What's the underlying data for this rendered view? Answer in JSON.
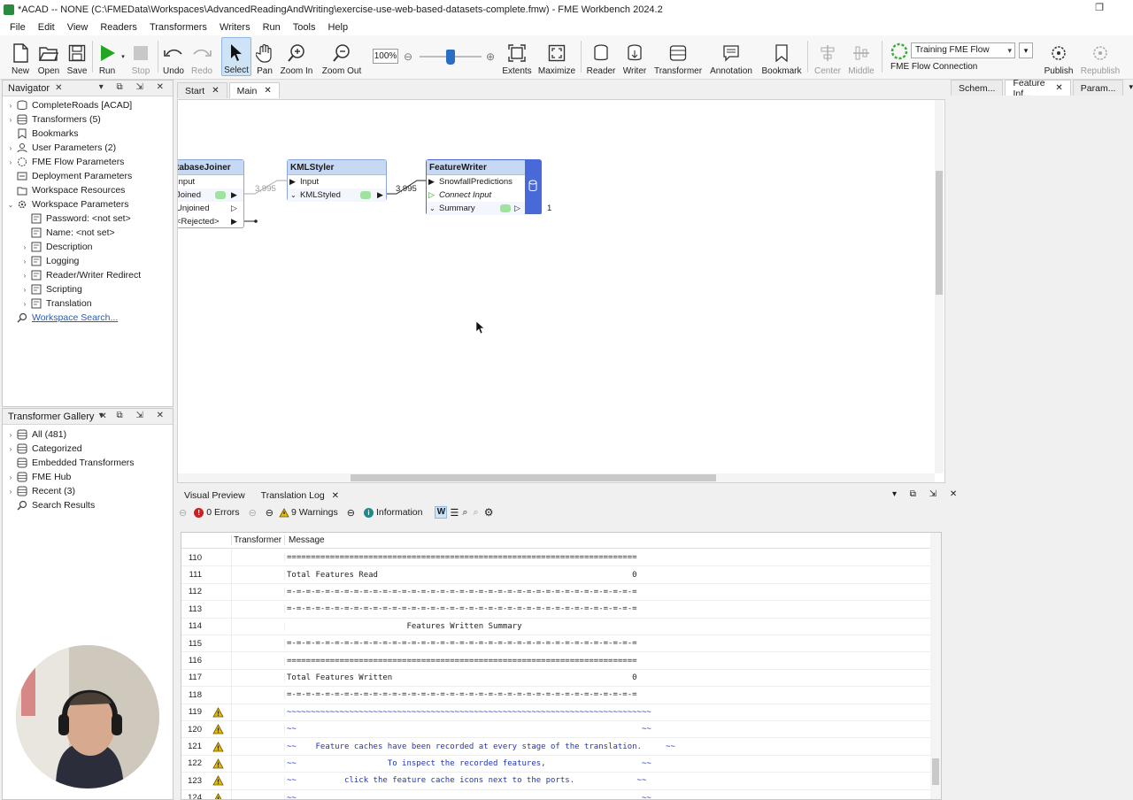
{
  "window": {
    "title": "*ACAD -- NONE (C:\\FMEData\\Workspaces\\AdvancedReadingAndWriting\\exercise-use-web-based-datasets-complete.fmw) - FME Workbench 2024.2"
  },
  "menu": [
    "File",
    "Edit",
    "View",
    "Readers",
    "Transformers",
    "Writers",
    "Run",
    "Tools",
    "Help"
  ],
  "toolbar": {
    "new": "New",
    "open": "Open",
    "save": "Save",
    "run": "Run",
    "stop": "Stop",
    "undo": "Undo",
    "redo": "Redo",
    "select": "Select",
    "pan": "Pan",
    "zoom_in": "Zoom In",
    "zoom_out": "Zoom Out",
    "zoom_level": "100%",
    "extents": "Extents",
    "maximize": "Maximize",
    "reader": "Reader",
    "writer": "Writer",
    "transformer": "Transformer",
    "annotation": "Annotation",
    "bookmark": "Bookmark",
    "center": "Center",
    "middle": "Middle",
    "flow_connection": "FME Flow Connection",
    "flow_combo": "Training FME Flow",
    "publish": "Publish",
    "republish": "Republish"
  },
  "navigator": {
    "title": "Navigator",
    "items": [
      {
        "label": "CompleteRoads [ACAD]"
      },
      {
        "label": "Transformers (5)"
      },
      {
        "label": "Bookmarks"
      },
      {
        "label": "User Parameters (2)"
      },
      {
        "label": "FME Flow Parameters"
      },
      {
        "label": "Deployment Parameters"
      },
      {
        "label": "Workspace Resources"
      },
      {
        "label": "Workspace Parameters"
      },
      {
        "label": "Password: <not set>"
      },
      {
        "label": "Name: <not set>"
      },
      {
        "label": "Description"
      },
      {
        "label": "Logging"
      },
      {
        "label": "Reader/Writer Redirect"
      },
      {
        "label": "Scripting"
      },
      {
        "label": "Translation"
      },
      {
        "label": "Workspace Search..."
      }
    ]
  },
  "gallery": {
    "title": "Transformer Gallery",
    "items": [
      {
        "label": "All (481)"
      },
      {
        "label": "Categorized"
      },
      {
        "label": "Embedded Transformers"
      },
      {
        "label": "FME Hub"
      },
      {
        "label": "Recent (3)"
      },
      {
        "label": "Search Results"
      }
    ]
  },
  "canvas_tabs": [
    "Start",
    "Main"
  ],
  "right_tabs": [
    "Schem...",
    "Feature Inf...",
    "Param..."
  ],
  "transformers": {
    "joiner": {
      "name": "tabaseJoiner",
      "ports": [
        "Input",
        "Joined",
        "Unjoined",
        "<Rejected>"
      ]
    },
    "kmlstyler": {
      "name": "KMLStyler",
      "ports": [
        "Input",
        "KMLStyled"
      ]
    },
    "writer": {
      "name": "FeatureWriter",
      "ports": [
        "SnowfallPredictions",
        "Connect Input",
        "Summary"
      ]
    },
    "count_joined": "3,995",
    "count_styled": "3,995",
    "count_summary": "1"
  },
  "bottom_tabs": [
    "Visual Preview",
    "Translation Log"
  ],
  "log_toolbar": {
    "errors": "0 Errors",
    "warnings": "9 Warnings",
    "information": "Information"
  },
  "log_columns": {
    "transformer": "Transformer",
    "message": "Message"
  },
  "log_rows": [
    {
      "n": "110",
      "warn": false,
      "msg": "=========================================================================",
      "blue": false
    },
    {
      "n": "111",
      "warn": false,
      "msg": "Total Features Read                                                     0",
      "blue": false
    },
    {
      "n": "112",
      "warn": false,
      "msg": "=-=-=-=-=-=-=-=-=-=-=-=-=-=-=-=-=-=-=-=-=-=-=-=-=-=-=-=-=-=-=-=-=-=-=-=-=",
      "blue": false
    },
    {
      "n": "113",
      "warn": false,
      "msg": "=-=-=-=-=-=-=-=-=-=-=-=-=-=-=-=-=-=-=-=-=-=-=-=-=-=-=-=-=-=-=-=-=-=-=-=-=",
      "blue": false
    },
    {
      "n": "114",
      "warn": false,
      "msg": "                         Features Written Summary",
      "blue": false
    },
    {
      "n": "115",
      "warn": false,
      "msg": "=-=-=-=-=-=-=-=-=-=-=-=-=-=-=-=-=-=-=-=-=-=-=-=-=-=-=-=-=-=-=-=-=-=-=-=-=",
      "blue": false
    },
    {
      "n": "116",
      "warn": false,
      "msg": "=========================================================================",
      "blue": false
    },
    {
      "n": "117",
      "warn": false,
      "msg": "Total Features Written                                                  0",
      "blue": false
    },
    {
      "n": "118",
      "warn": false,
      "msg": "=-=-=-=-=-=-=-=-=-=-=-=-=-=-=-=-=-=-=-=-=-=-=-=-=-=-=-=-=-=-=-=-=-=-=-=-=",
      "blue": false
    },
    {
      "n": "119",
      "warn": true,
      "msg": "~~~~~~~~~~~~~~~~~~~~~~~~~~~~~~~~~~~~~~~~~~~~~~~~~~~~~~~~~~~~~~~~~~~~~~~~~~~~",
      "blue": true
    },
    {
      "n": "120",
      "warn": true,
      "msg": "~~                                                                        ~~",
      "blue": true
    },
    {
      "n": "121",
      "warn": true,
      "msg": "~~    Feature caches have been recorded at every stage of the translation.     ~~",
      "blue": true
    },
    {
      "n": "122",
      "warn": true,
      "msg": "~~                   To inspect the recorded features,                    ~~",
      "blue": true
    },
    {
      "n": "123",
      "warn": true,
      "msg": "~~          click the feature cache icons next to the ports.             ~~",
      "blue": true
    },
    {
      "n": "124",
      "warn": true,
      "msg": "~~                                                                        ~~",
      "blue": true
    }
  ],
  "colors": {
    "accent": "#2b6cc4",
    "run_green": "#22a522",
    "writer_band": "#4a69d9",
    "warn": "#e6b800"
  }
}
